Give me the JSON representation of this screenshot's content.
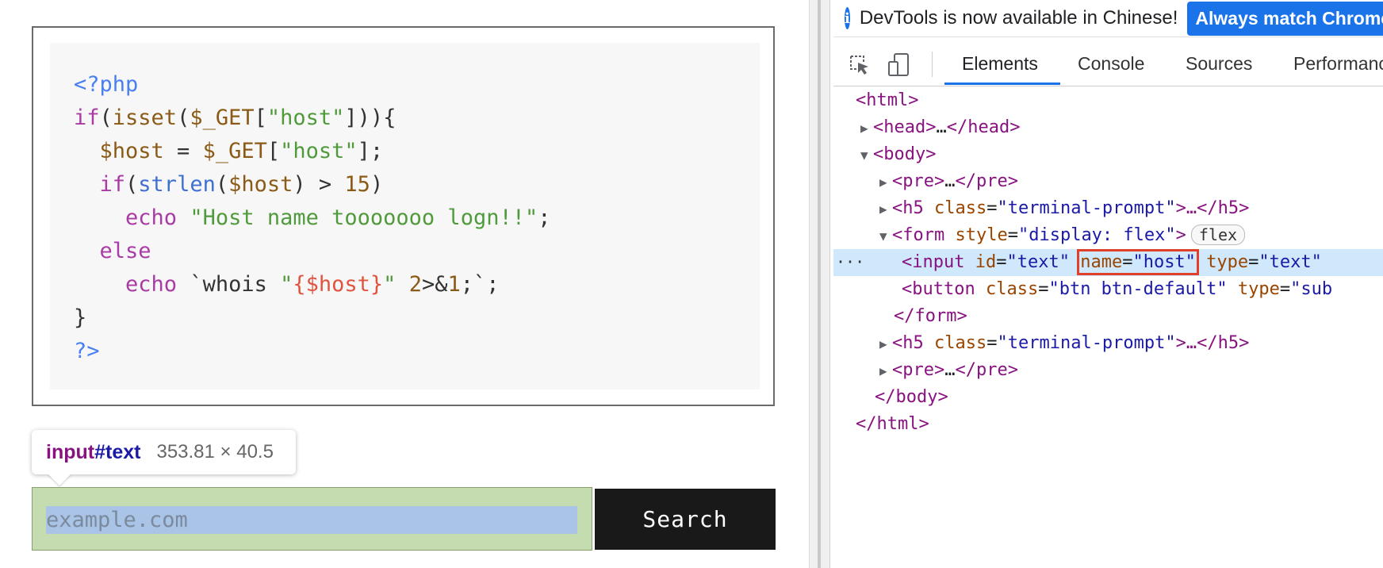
{
  "code": {
    "lines": [
      [
        {
          "t": "<?php",
          "c": "c-blue"
        }
      ],
      [
        {
          "t": "if",
          "c": "c-purple"
        },
        {
          "t": "(",
          "c": ""
        },
        {
          "t": "isset",
          "c": "c-brown"
        },
        {
          "t": "(",
          "c": ""
        },
        {
          "t": "$_GET",
          "c": "c-brown"
        },
        {
          "t": "[",
          "c": ""
        },
        {
          "t": "\"host\"",
          "c": "c-green"
        },
        {
          "t": "])){",
          "c": ""
        }
      ],
      [
        {
          "t": "  ",
          "c": ""
        },
        {
          "t": "$host",
          "c": "c-brown"
        },
        {
          "t": " = ",
          "c": ""
        },
        {
          "t": "$_GET",
          "c": "c-brown"
        },
        {
          "t": "[",
          "c": ""
        },
        {
          "t": "\"host\"",
          "c": "c-green"
        },
        {
          "t": "];",
          "c": ""
        }
      ],
      [
        {
          "t": "  ",
          "c": ""
        },
        {
          "t": "if",
          "c": "c-purple"
        },
        {
          "t": "(",
          "c": ""
        },
        {
          "t": "strlen",
          "c": "c-fn"
        },
        {
          "t": "(",
          "c": ""
        },
        {
          "t": "$host",
          "c": "c-brown"
        },
        {
          "t": ") > ",
          "c": ""
        },
        {
          "t": "15",
          "c": "c-brown"
        },
        {
          "t": ")",
          "c": ""
        }
      ],
      [
        {
          "t": "    ",
          "c": ""
        },
        {
          "t": "echo",
          "c": "c-purple"
        },
        {
          "t": " ",
          "c": ""
        },
        {
          "t": "\"Host name tooooooo logn!!\"",
          "c": "c-green"
        },
        {
          "t": ";",
          "c": ""
        }
      ],
      [
        {
          "t": "  ",
          "c": ""
        },
        {
          "t": "else",
          "c": "c-purple"
        }
      ],
      [
        {
          "t": "    ",
          "c": ""
        },
        {
          "t": "echo",
          "c": "c-purple"
        },
        {
          "t": " `whois ",
          "c": ""
        },
        {
          "t": "\"",
          "c": "c-green"
        },
        {
          "t": "{$host}",
          "c": "c-red"
        },
        {
          "t": "\"",
          "c": "c-green"
        },
        {
          "t": " ",
          "c": ""
        },
        {
          "t": "2",
          "c": "c-brown"
        },
        {
          "t": ">&",
          "c": ""
        },
        {
          "t": "1",
          "c": "c-brown"
        },
        {
          "t": ";`;",
          "c": ""
        }
      ],
      [
        {
          "t": "}",
          "c": ""
        }
      ],
      [
        {
          "t": "?>",
          "c": "c-blue"
        }
      ]
    ]
  },
  "tooltip": {
    "selector_tag": "input",
    "selector_id": "#text",
    "dimensions": "353.81 × 40.5"
  },
  "search": {
    "placeholder": "example.com",
    "button_label": "Search"
  },
  "devtools": {
    "infobar": {
      "message": "DevTools is now available in Chinese!",
      "button": "Always match Chrome"
    },
    "tabs": [
      "Elements",
      "Console",
      "Sources",
      "Performance"
    ],
    "active_tab": "Elements",
    "dom": {
      "l1": "<html>",
      "l2_open": "<head>",
      "l2_ell": "…",
      "l2_close": "</head>",
      "l3": "<body>",
      "l4_open": "<pre>",
      "l4_ell": "…",
      "l4_close": "</pre>",
      "l5_tag": "<h5",
      "l5_attr": "class",
      "l5_val": "\"terminal-prompt\"",
      "l5_end": ">…</h5>",
      "l6_tag": "<form",
      "l6_attr": "style",
      "l6_val": "\"display: flex\"",
      "l6_end": ">",
      "l6_badge": "flex",
      "l7_tag": "<input",
      "l7_a1": "id",
      "l7_v1": "\"text\"",
      "l7_a2": "name",
      "l7_v2": "\"host\"",
      "l7_a3": "type",
      "l7_v3": "\"text\"",
      "l8_tag": "<button",
      "l8_a1": "class",
      "l8_v1": "\"btn btn-default\"",
      "l8_a2": "type",
      "l8_v2": "\"sub",
      "l9": "</form>",
      "l10_tag": "<h5",
      "l10_attr": "class",
      "l10_val": "\"terminal-prompt\"",
      "l10_end": ">…</h5>",
      "l11_open": "<pre>",
      "l11_ell": "…",
      "l11_close": "</pre>",
      "l12": "</body>",
      "l13": "</html>",
      "ellipsis": "···"
    }
  }
}
